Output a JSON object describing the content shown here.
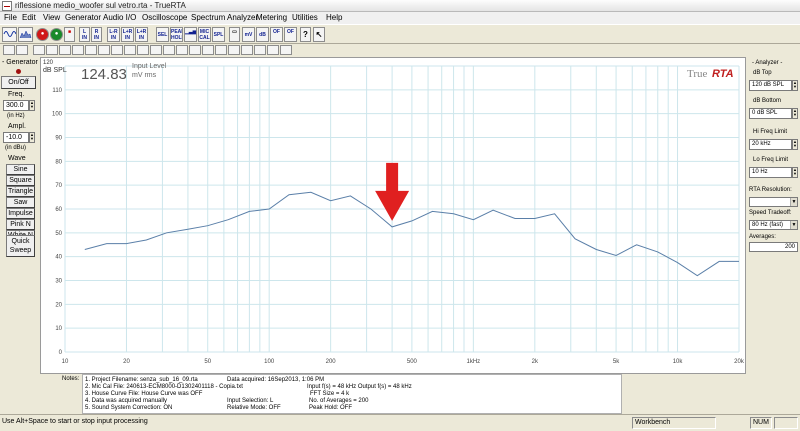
{
  "window": {
    "title": "riflessione medio_woofer sul vetro.rta - TrueRTA"
  },
  "menu": [
    "File",
    "Edit",
    "View",
    "Generator",
    "Audio I/O",
    "Oscilloscope",
    "Spectrum Analyzer",
    "Metering",
    "Utilities",
    "Help"
  ],
  "toolbar": {
    "buttons": [
      "L IN",
      "R IN",
      "L-R IN",
      "L+R IN",
      "L+R IN",
      "SEL",
      "PEAK HOLD",
      "MIC CAL",
      "SPL",
      "mV",
      "dB",
      "OF",
      "OF",
      "?"
    ]
  },
  "generator": {
    "title": "- Generator -",
    "onoff_label": "On/Off",
    "freq_label": "Freq.",
    "freq_value": "300.0",
    "freq_unit": "(in Hz)",
    "ampl_label": "Ampl.",
    "ampl_value": "-10.0",
    "ampl_unit": "(in dBu)",
    "wave_label": "Wave",
    "waves": [
      "Sine",
      "Square",
      "Triangle",
      "Saw",
      "Impulse",
      "Pink N",
      "White N"
    ],
    "quick_sweep_1": "Quick",
    "quick_sweep_2": "Sweep"
  },
  "plot": {
    "y_unit": "dB SPL",
    "y_top_label": "120",
    "level_value": "124.83",
    "level_label_1": "Input Level",
    "level_label_2": "mV rms",
    "logo_true": "True",
    "logo_rta": "RTA"
  },
  "chart_data": {
    "type": "line",
    "x_scale": "log",
    "xlim": [
      10,
      20000
    ],
    "ylim": [
      0,
      120
    ],
    "x_tick_labels": [
      "10",
      "20",
      "50",
      "100",
      "200",
      "500",
      "1kHz",
      "2k",
      "5k",
      "10k",
      "20k"
    ],
    "y_tick_labels": [
      "120",
      "110",
      "100",
      "90",
      "80",
      "70",
      "60",
      "50",
      "40",
      "30",
      "20",
      "10",
      "0"
    ],
    "ylabel": "dB SPL",
    "grid": true,
    "series": [
      {
        "color": "#5a7fa8",
        "x": [
          12.5,
          16,
          20,
          25,
          31.5,
          40,
          50,
          63,
          80,
          100,
          125,
          160,
          200,
          250,
          315,
          400,
          500,
          630,
          800,
          1000,
          1250,
          1600,
          2000,
          2500,
          3150,
          4000,
          5000,
          6300,
          8000,
          10000,
          12500,
          16000,
          20000
        ],
        "y": [
          43,
          45.5,
          45.5,
          47,
          50,
          51.5,
          53,
          55.5,
          59,
          60,
          66,
          67,
          63.5,
          65.5,
          60,
          52.5,
          55,
          59,
          58,
          55.5,
          59.5,
          56,
          56,
          58,
          47.5,
          43,
          40.5,
          45,
          42,
          37.5,
          32,
          38,
          38
        ]
      }
    ],
    "annotations": [
      {
        "type": "arrow",
        "color": "#e02020",
        "points_to": {
          "x": 400,
          "y": 52.5
        }
      }
    ]
  },
  "analyzer": {
    "title": "- Analyzer -",
    "db_top_label": "dB Top",
    "db_top_value": "120 dB SPL",
    "db_bottom_label": "dB Bottom",
    "db_bottom_value": "0 dB SPL",
    "hi_freq_label": "Hi Freq Limit",
    "hi_freq_value": "20 kHz",
    "lo_freq_label": "Lo Freq Limit",
    "lo_freq_value": "10 Hz",
    "rta_res_label": "RTA Resolution:",
    "rta_res_value": "",
    "speed_label": "Speed Tradeoff:",
    "speed_value": "80 Hz (fast)",
    "averages_label": "Averages:",
    "averages_value": "200"
  },
  "notes": {
    "label": "Notes:",
    "lines": [
      "1. Project Filename: senza_sub_16_09.rta",
      "2. Mic Cal File: 240613-ECM8000-D1302401118 - Copia.txt",
      "3. House Curve File: House Curve was OFF",
      "4. Data was acquired manually",
      "5. Sound System Correction: ON"
    ],
    "col2": [
      "Data acquired: 16Sep2013, 1:06 PM",
      "Input f(s) = 48 kHz    Output f(s) = 48 kHz",
      "FFT Size = 4 k",
      "Input Selection: L",
      "Relative Mode: OFF"
    ],
    "col3": [
      "No. of Averages = 200",
      "Peak Hold: OFF"
    ]
  },
  "status": {
    "hint": "Use Alt+Space to start or stop input processing",
    "workbench": "Workbench",
    "num": "NUM"
  }
}
